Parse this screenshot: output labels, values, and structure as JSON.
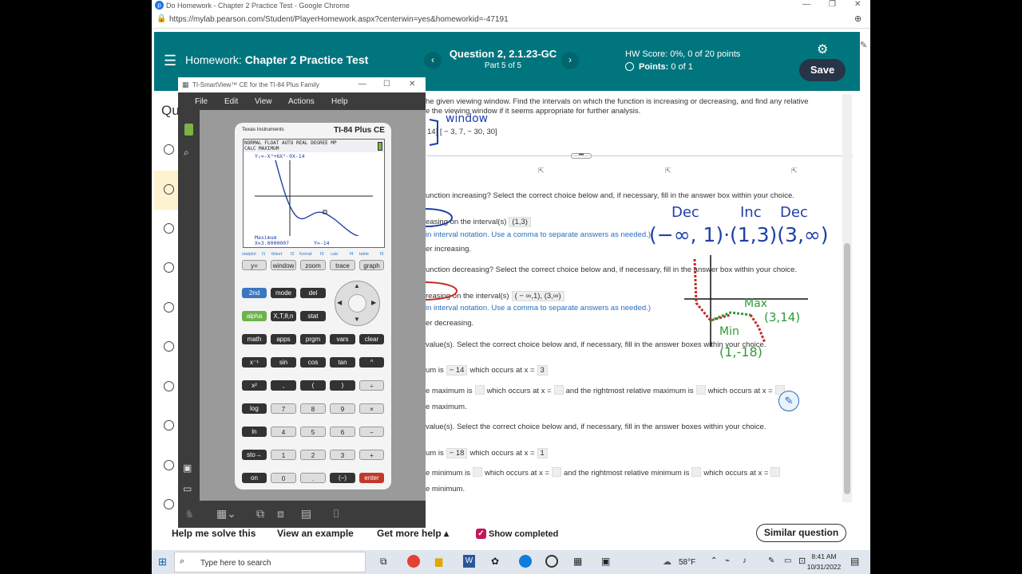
{
  "browser": {
    "title": "Do Homework - Chapter 2 Practice Test - Google Chrome",
    "url": "https://mylab.pearson.com/Student/PlayerHomework.aspx?centerwin=yes&homeworkid=-47191"
  },
  "header": {
    "homework_prefix": "Homework:",
    "homework_title": "Chapter 2 Practice Test",
    "question_title": "Question 2, 2.1.23-GC",
    "question_sub": "Part 5 of 5",
    "hw_score": "HW Score: 0%, 0 of 20 points",
    "points_label": "Points:",
    "points_value": "0 of 1",
    "save_label": "Save",
    "prev": "‹",
    "next": "›"
  },
  "question_label": "Qu",
  "content": {
    "intro1": "he given viewing window. Find the intervals on which the function is increasing or decreasing, and find any relative",
    "intro2": "e the viewing window if it seems appropriate for further analysis.",
    "window_vals": "14] [ − 3, 7, − 30, 30]",
    "q_inc": "unction increasing? Select the correct choice below and, if necessary, fill in the answer box within your choice.",
    "inc_a_pre": "easing on the interval(s)",
    "inc_a_val": "(1,3)",
    "inc_note": "in interval notation. Use a comma to separate answers as needed.)",
    "inc_b": "er increasing.",
    "q_dec": "unction decreasing? Select the correct choice below and, if necessary, fill in the answer box within your choice.",
    "dec_a_pre": "reasing on the interval(s)",
    "dec_a_val": "( − ∞,1), (3,∞)",
    "dec_note": "in interval notation. Use a comma to separate answers as needed.)",
    "dec_b": "er decreasing.",
    "q_max": "value(s). Select the correct choice below and, if necessary, fill in the answer boxes within your choice.",
    "max_a_pre": "um is",
    "max_a_val": "− 14",
    "max_a_mid": "which occurs at x =",
    "max_a_x": "3",
    "max_b1": "e maximum is",
    "max_b2": "which occurs at x =",
    "max_b3": "and the rightmost relative maximum is",
    "max_b4": "which occurs at x =",
    "max_c": "e maximum.",
    "q_min": "value(s). Select the correct choice below and, if necessary, fill in the answer boxes within your choice.",
    "min_a_pre": "um is",
    "min_a_val": "− 18",
    "min_a_mid": "which occurs at x =",
    "min_a_x": "1",
    "min_b1": "e minimum is",
    "min_b2": "which occurs at x =",
    "min_b3": "and the rightmost relative minimum is",
    "min_b4": "which occurs at x =",
    "min_c": "e minimum."
  },
  "annotations": {
    "window": "window",
    "dec1": "Dec",
    "inc": "Inc",
    "dec2": "Dec",
    "intervals": "(−∞, 1)·(1,3)(3,∞)",
    "max": "Max",
    "max_pt": "(3,14)",
    "min": "Min",
    "min_pt": "(1,-18)"
  },
  "calculator": {
    "window_title": "TI-SmartView™ CE for the TI-84 Plus Family",
    "menu": [
      "File",
      "Edit",
      "View",
      "Actions",
      "Help"
    ],
    "brand": "Texas Instruments",
    "model": "TI-84 Plus CE",
    "status1": "NORMAL FLOAT AUTO REAL DEGREE MP",
    "status2": "CALC MAXIMUM",
    "equation": "Y₁=-X³+6X²-9X-14",
    "result_label": "Maximum",
    "result_x": "X=3.0000007",
    "result_y": "Y=-14",
    "func_labels": [
      "statplot",
      "f1",
      "tblset",
      "f2",
      "format",
      "f3",
      "calc",
      "f4",
      "table",
      "f5"
    ],
    "func_keys": [
      "y=",
      "window",
      "zoom",
      "trace",
      "graph"
    ],
    "rows": [
      [
        "2nd",
        "mode",
        "del"
      ],
      [
        "alpha",
        "X,T,θ,n",
        "stat"
      ],
      [
        "math",
        "apps",
        "prgm",
        "vars",
        "clear"
      ],
      [
        "x⁻¹",
        "sin",
        "cos",
        "tan",
        "^"
      ],
      [
        "x²",
        ",",
        "(",
        ")",
        "÷"
      ],
      [
        "log",
        "7",
        "8",
        "9",
        "×"
      ],
      [
        "ln",
        "4",
        "5",
        "6",
        "−"
      ],
      [
        "sto→",
        "1",
        "2",
        "3",
        "+"
      ],
      [
        "on",
        "0",
        ".",
        "(−)",
        "enter"
      ]
    ]
  },
  "bottom": {
    "help": "Help me solve this",
    "example": "View an example",
    "more": "Get more help ▴",
    "show_completed": "Show completed",
    "similar": "Similar question"
  },
  "taskbar": {
    "search": "Type here to search",
    "weather": "58°F",
    "time": "8:41 AM",
    "date": "10/31/2022"
  }
}
